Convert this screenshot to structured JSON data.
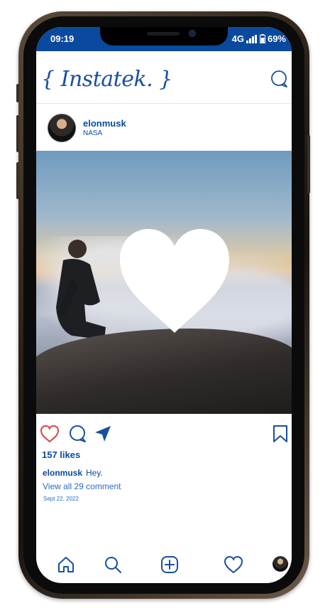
{
  "status_bar": {
    "time": "09:19",
    "network": "4G",
    "battery": "69%"
  },
  "app": {
    "logo_text": "{ Instatek. }",
    "header_icon": "message-bubble-icon"
  },
  "post": {
    "username": "elonmusk",
    "location": "NASA",
    "image_overlay_icon": "heart-icon",
    "likes_text": "157 likes",
    "caption_user": "elonmusk",
    "caption_text": "Hey.",
    "view_comments_text": "View all 29 comment",
    "date_text": "Sept 22, 2022"
  },
  "actions": {
    "like_icon": "heart-outline-icon",
    "comment_icon": "comment-icon",
    "share_icon": "send-icon",
    "save_icon": "bookmark-icon"
  },
  "bottom_nav": {
    "items": [
      "home-icon",
      "search-icon",
      "add-post-icon",
      "activity-heart-icon",
      "profile-avatar"
    ]
  },
  "colors": {
    "brand_blue": "#0a4a9e",
    "link_blue": "#2a6bc4",
    "like_red": "#e0404a"
  }
}
